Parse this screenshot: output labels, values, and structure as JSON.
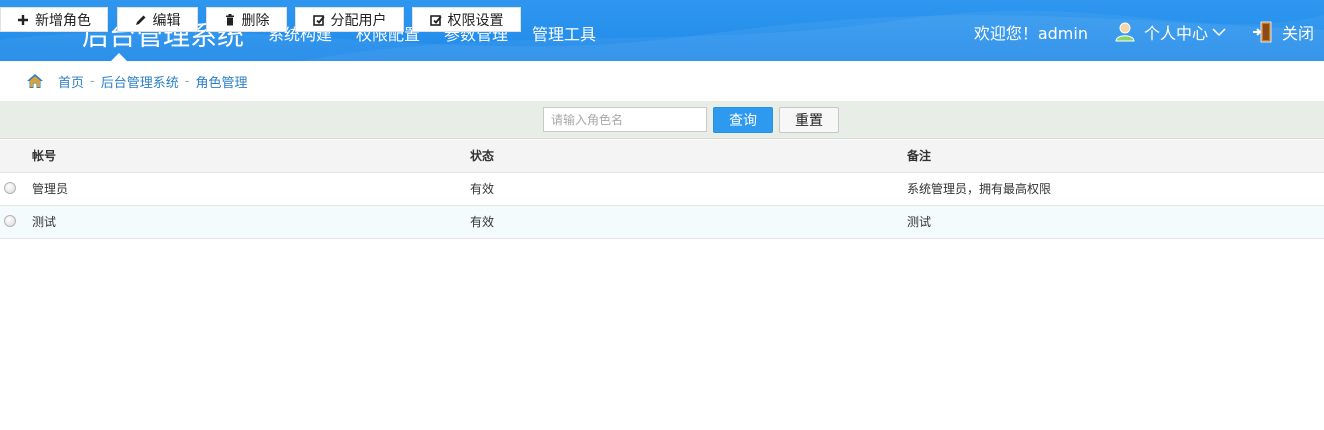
{
  "header": {
    "title": "后台管理系统",
    "nav": [
      "系统构建",
      "权限配置",
      "参数管理",
      "管理工具"
    ],
    "welcome": "欢迎您！admin",
    "user_center": "个人中心",
    "close": "关闭",
    "colors": {
      "bar": "#1f8ae8",
      "text": "#ffffff"
    }
  },
  "breadcrumb": {
    "items": [
      "首页",
      "后台管理系统",
      "角色管理"
    ],
    "separator": "-"
  },
  "toolbar": {
    "buttons": [
      {
        "label": "新增角色",
        "icon": "plus-icon"
      },
      {
        "label": "编辑",
        "icon": "pencil-icon"
      },
      {
        "label": "删除",
        "icon": "trash-icon"
      },
      {
        "label": "分配用户",
        "icon": "checkbox-edit-icon"
      },
      {
        "label": "权限设置",
        "icon": "checkbox-edit-icon"
      }
    ],
    "search_placeholder": "请输入角色名",
    "query_label": "查询",
    "reset_label": "重置",
    "query_color": "#2d9af0"
  },
  "table": {
    "columns": [
      "帐号",
      "状态",
      "备注"
    ],
    "rows": [
      {
        "account": "管理员",
        "status": "有效",
        "note": "系统管理员，拥有最高权限"
      },
      {
        "account": "测试",
        "status": "有效",
        "note": "测试"
      }
    ]
  }
}
